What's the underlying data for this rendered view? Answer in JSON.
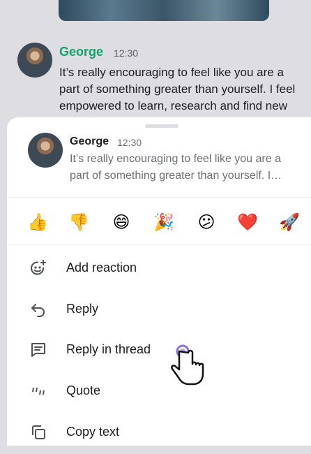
{
  "background_message": {
    "author": "George",
    "time": "12:30",
    "text": "It’s really encouraging to feel like you are a part of something greater than yourself. I feel empowered to learn, research and find new"
  },
  "preview": {
    "author": "George",
    "time": "12:30",
    "text": "It’s really encouraging to feel like you are a part of something greater than yourself. I…"
  },
  "reactions": [
    "👍",
    "👎",
    "😄",
    "🎉",
    "😕",
    "❤️",
    "🚀"
  ],
  "menu": {
    "add_reaction": "Add reaction",
    "reply": "Reply",
    "reply_in_thread": "Reply in thread",
    "quote": "Quote",
    "copy_text": "Copy text"
  },
  "colors": {
    "author_accent": "#17a06b",
    "overlay": "#dedee2",
    "heart": "#d92b2b"
  }
}
